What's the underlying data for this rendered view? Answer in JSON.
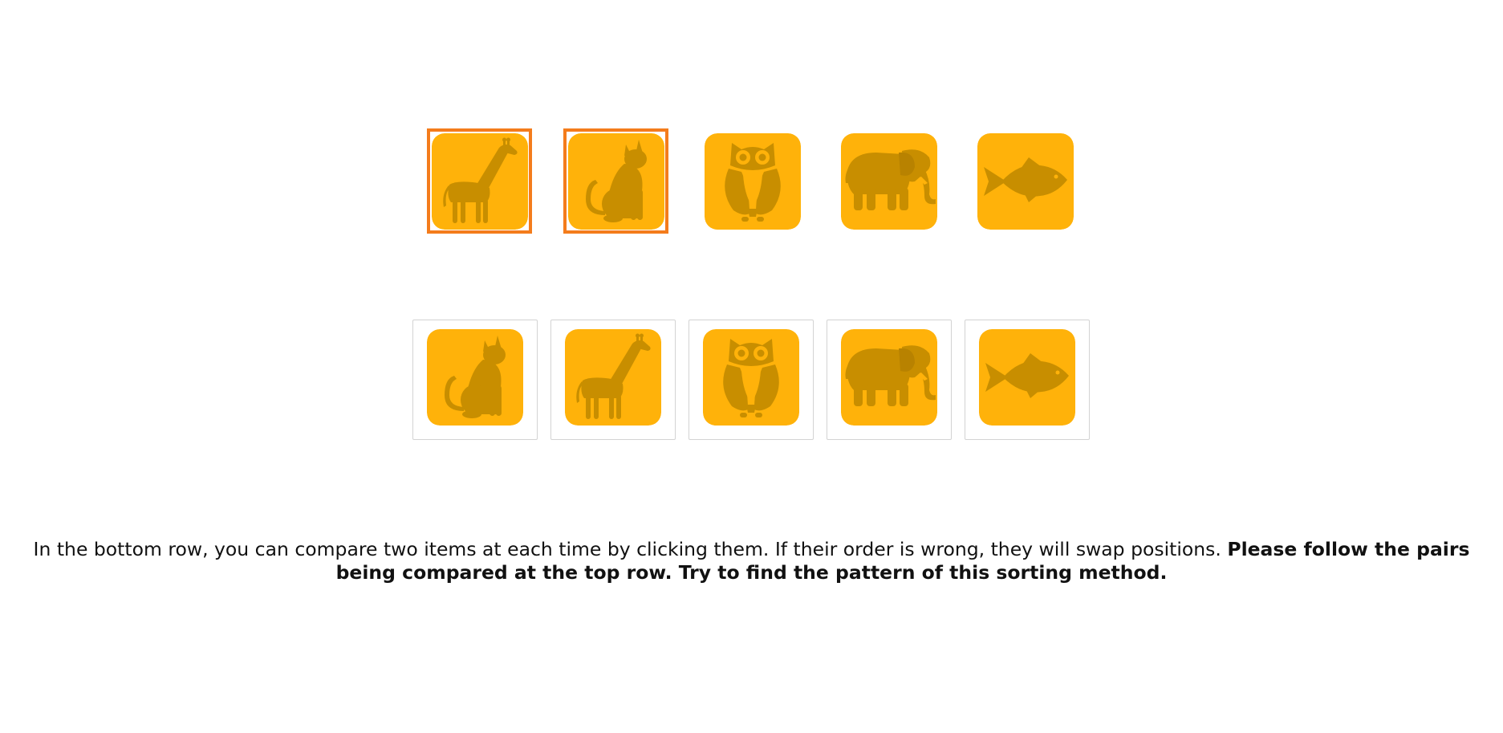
{
  "colors": {
    "tile_background": "#FFB20A",
    "icon_fill": "#C88E00",
    "compare_highlight": "#F47C1C",
    "card_border": "#D3D3D3"
  },
  "top_row": {
    "items": [
      {
        "animal": "giraffe",
        "icon": "giraffe-icon",
        "being_compared": true
      },
      {
        "animal": "cat",
        "icon": "cat-icon",
        "being_compared": true
      },
      {
        "animal": "owl",
        "icon": "owl-icon",
        "being_compared": false
      },
      {
        "animal": "elephant",
        "icon": "elephant-icon",
        "being_compared": false
      },
      {
        "animal": "fish",
        "icon": "fish-icon",
        "being_compared": false
      }
    ]
  },
  "bottom_row": {
    "items": [
      {
        "animal": "cat",
        "icon": "cat-icon"
      },
      {
        "animal": "giraffe",
        "icon": "giraffe-icon"
      },
      {
        "animal": "owl",
        "icon": "owl-icon"
      },
      {
        "animal": "elephant",
        "icon": "elephant-icon"
      },
      {
        "animal": "fish",
        "icon": "fish-icon"
      }
    ]
  },
  "instructions": {
    "normal": "In the bottom row, you can compare two items at each time by clicking them. If their order is wrong, they will swap positions. ",
    "bold": "Please follow the pairs being compared at the top row. Try to find the pattern of this sorting method."
  }
}
